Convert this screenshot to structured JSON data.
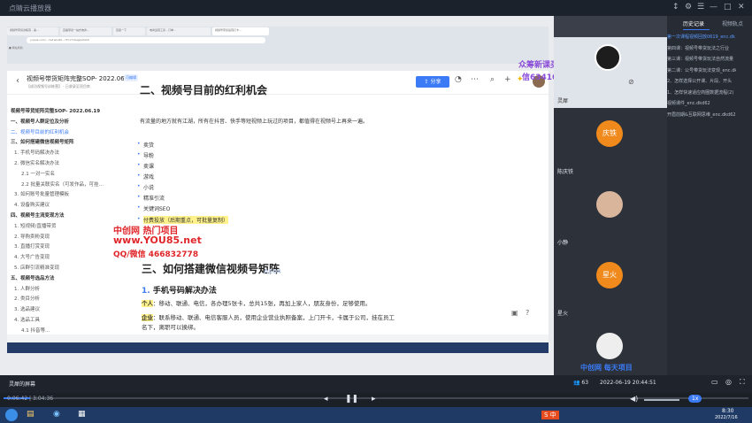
{
  "app": {
    "title": "点睛云播放器",
    "window_controls": [
      "↕",
      "⚙",
      "☰",
      "—",
      "□",
      "✕"
    ]
  },
  "browser": {
    "tabs": [
      "视频号带货训练营 - 第… ",
      "直播带货一站式电商… ",
      "百度一下",
      "电商运营工具 - 订单… ",
      "视频号带货运营打卡…"
    ],
    "address": "yuque.com/…/ra1aAuZs…?t=x7x0ugqv0ahX",
    "bookmark": "■ 网站导航"
  },
  "doc": {
    "title": "视频号带货矩阵完整SOP- 2022.06.19",
    "tag": "可编辑",
    "subtitle": "【成功视频号训练营】  · 已收录至项目库",
    "share_label": "分享",
    "top_heading": "二、视频号目前的红利机会",
    "toc": [
      {
        "label": "视频号带货矩阵完整SOP- 2022.06.19",
        "style": "head"
      },
      {
        "label": "一、视频号人群定位及分析",
        "style": "head"
      },
      {
        "label": "二、视频号目前的红利机会",
        "style": "active"
      },
      {
        "label": "三、如何搭建微信视频号矩阵",
        "style": "head"
      },
      {
        "label": "1. 手机号码解决办法",
        "style": "sub"
      },
      {
        "label": "2. 微信实名解决办法",
        "style": "sub"
      },
      {
        "label": "2.1 一对一实名",
        "style": "sub"
      },
      {
        "label": "2.2 批量关联实名（可发作品，可挂…",
        "style": "sub"
      },
      {
        "label": "3. 如何账号批量管理模板",
        "style": "sub"
      },
      {
        "label": "4. 设备购买建议",
        "style": "sub"
      },
      {
        "label": "四、视频号主流变现方法",
        "style": "head"
      },
      {
        "label": "1. 短视频/直播带货",
        "style": "sub"
      },
      {
        "label": "2. 导购卖粉变现",
        "style": "sub"
      },
      {
        "label": "3. 直播打赏变现",
        "style": "sub"
      },
      {
        "label": "4. 大号广告变现",
        "style": "sub"
      },
      {
        "label": "5. 店群引流精准变现",
        "style": "sub"
      },
      {
        "label": "五、视频号选品方法",
        "style": "head"
      },
      {
        "label": "1. 人群分析",
        "style": "sub"
      },
      {
        "label": "2. 类目分析",
        "style": "sub"
      },
      {
        "label": "3. 选品建议",
        "style": "sub"
      },
      {
        "label": "4. 选品工具",
        "style": "sub"
      },
      {
        "label": "4.1 抖音等…",
        "style": "sub"
      }
    ],
    "intro": "有流量的地方就有江湖，所有在抖音、快手等短视频上玩过的项目，都值得在视频号上再来一遍。",
    "bullets": [
      "卖货",
      "导粉",
      "卖课",
      "游戏",
      "小说",
      "精准引流",
      "关键词SEO",
      "付费投放（后期重点，可批量复制）"
    ],
    "section_title": "三、如何搭建微信视频号矩阵",
    "sub_num": "1.",
    "sub_title": "手机号码解决办法",
    "line1_key": "个人",
    "line1": "：移动、联通、电信，各办理5张卡，总共15张，再加上家人，朋友身份，足够使用。",
    "line2_key": "企业",
    "line2": "：联系移动、联通、电信客服人员，使用企业营业执照备案，上门开卡，卡属于公司，挂在员工",
    "line2b": "名下，离职可以换绑。"
  },
  "watermarks": {
    "brand": "中创网 热门项目",
    "url": "www.YOU85.net",
    "qq": "QQ/微信 466832778",
    "top_right": "众筹新课买系列",
    "top_right2": "信6341641",
    "bottom_right": "中创网 每天项目",
    "doc_wm": "A104"
  },
  "participants": [
    {
      "name": "灵犀",
      "kind": "obs"
    },
    {
      "name": "陈庆铁",
      "kind": "circle",
      "initials": "庆铁",
      "color": "#f08a1c"
    },
    {
      "name": "小静",
      "kind": "photo"
    },
    {
      "name": "星火",
      "kind": "circle",
      "initials": "星火",
      "color": "#f08a1c"
    },
    {
      "name": "十画",
      "kind": "photo"
    }
  ],
  "right_panel": {
    "tabs": [
      "历史记录",
      "视频轨点"
    ],
    "items": [
      "第一次课程视频回放0619_enc.dk",
      "第四课：视频号带货玩法之行业",
      "第三课：视频号带货玩法自然流量",
      "第二课：公号带货玩法变现_enc.dk",
      "2、怎样选择公开课、片段、开头",
      "1、怎样快速适应商圈数据流程(2)",
      "视频课件_enc.dkd62",
      "开眉前期&互联网思维_enc.dkd62"
    ]
  },
  "bottom": {
    "screen_label": "灵犀的屏幕",
    "viewer_count": "63",
    "timestamp": "2022-06-19 20:44:51"
  },
  "player": {
    "current": "0:06:42",
    "total": "3:04:36",
    "speed": "1x",
    "progress": 0.036
  },
  "system": {
    "clock": "8:30",
    "date": "2022/7/16"
  }
}
